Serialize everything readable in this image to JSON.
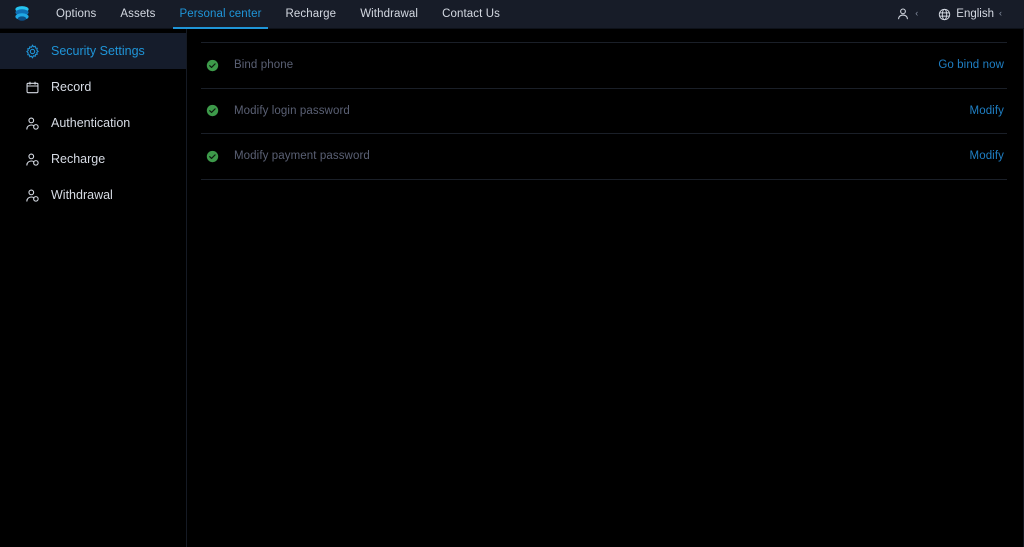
{
  "header": {
    "logo_icon": "stacked-layers-logo",
    "nav": [
      {
        "label": "Options",
        "active": false
      },
      {
        "label": "Assets",
        "active": false
      },
      {
        "label": "Personal center",
        "active": true
      },
      {
        "label": "Recharge",
        "active": false
      },
      {
        "label": "Withdrawal",
        "active": false
      },
      {
        "label": "Contact Us",
        "active": false
      }
    ],
    "account": {
      "icon": "user-icon",
      "caret": "‹"
    },
    "language": {
      "icon": "globe-icon",
      "label": "English",
      "caret": "‹"
    }
  },
  "sidebar": {
    "items": [
      {
        "label": "Security Settings",
        "icon": "gear-icon",
        "active": true
      },
      {
        "label": "Record",
        "icon": "calendar-icon",
        "active": false
      },
      {
        "label": "Authentication",
        "icon": "user-badge-icon",
        "active": false
      },
      {
        "label": "Recharge",
        "icon": "user-badge-icon",
        "active": false
      },
      {
        "label": "Withdrawal",
        "icon": "user-badge-icon",
        "active": false
      }
    ]
  },
  "main": {
    "rows": [
      {
        "label": "Bind phone",
        "action": "Go bind now",
        "status_icon": "check-circle-icon"
      },
      {
        "label": "Modify login password",
        "action": "Modify",
        "status_icon": "check-circle-icon"
      },
      {
        "label": "Modify payment password",
        "action": "Modify",
        "status_icon": "check-circle-icon"
      }
    ]
  },
  "colors": {
    "page_background": "#000000",
    "header_background": "#171c28",
    "accent_blue": "#1f95d8",
    "link_blue": "#1f7fc4",
    "status_green": "#3d9a4a",
    "muted_text": "#5a6074",
    "nav_text": "#d4d9e2",
    "sidebar_active_background": "#151c2b",
    "divider": "#1a1f28"
  }
}
